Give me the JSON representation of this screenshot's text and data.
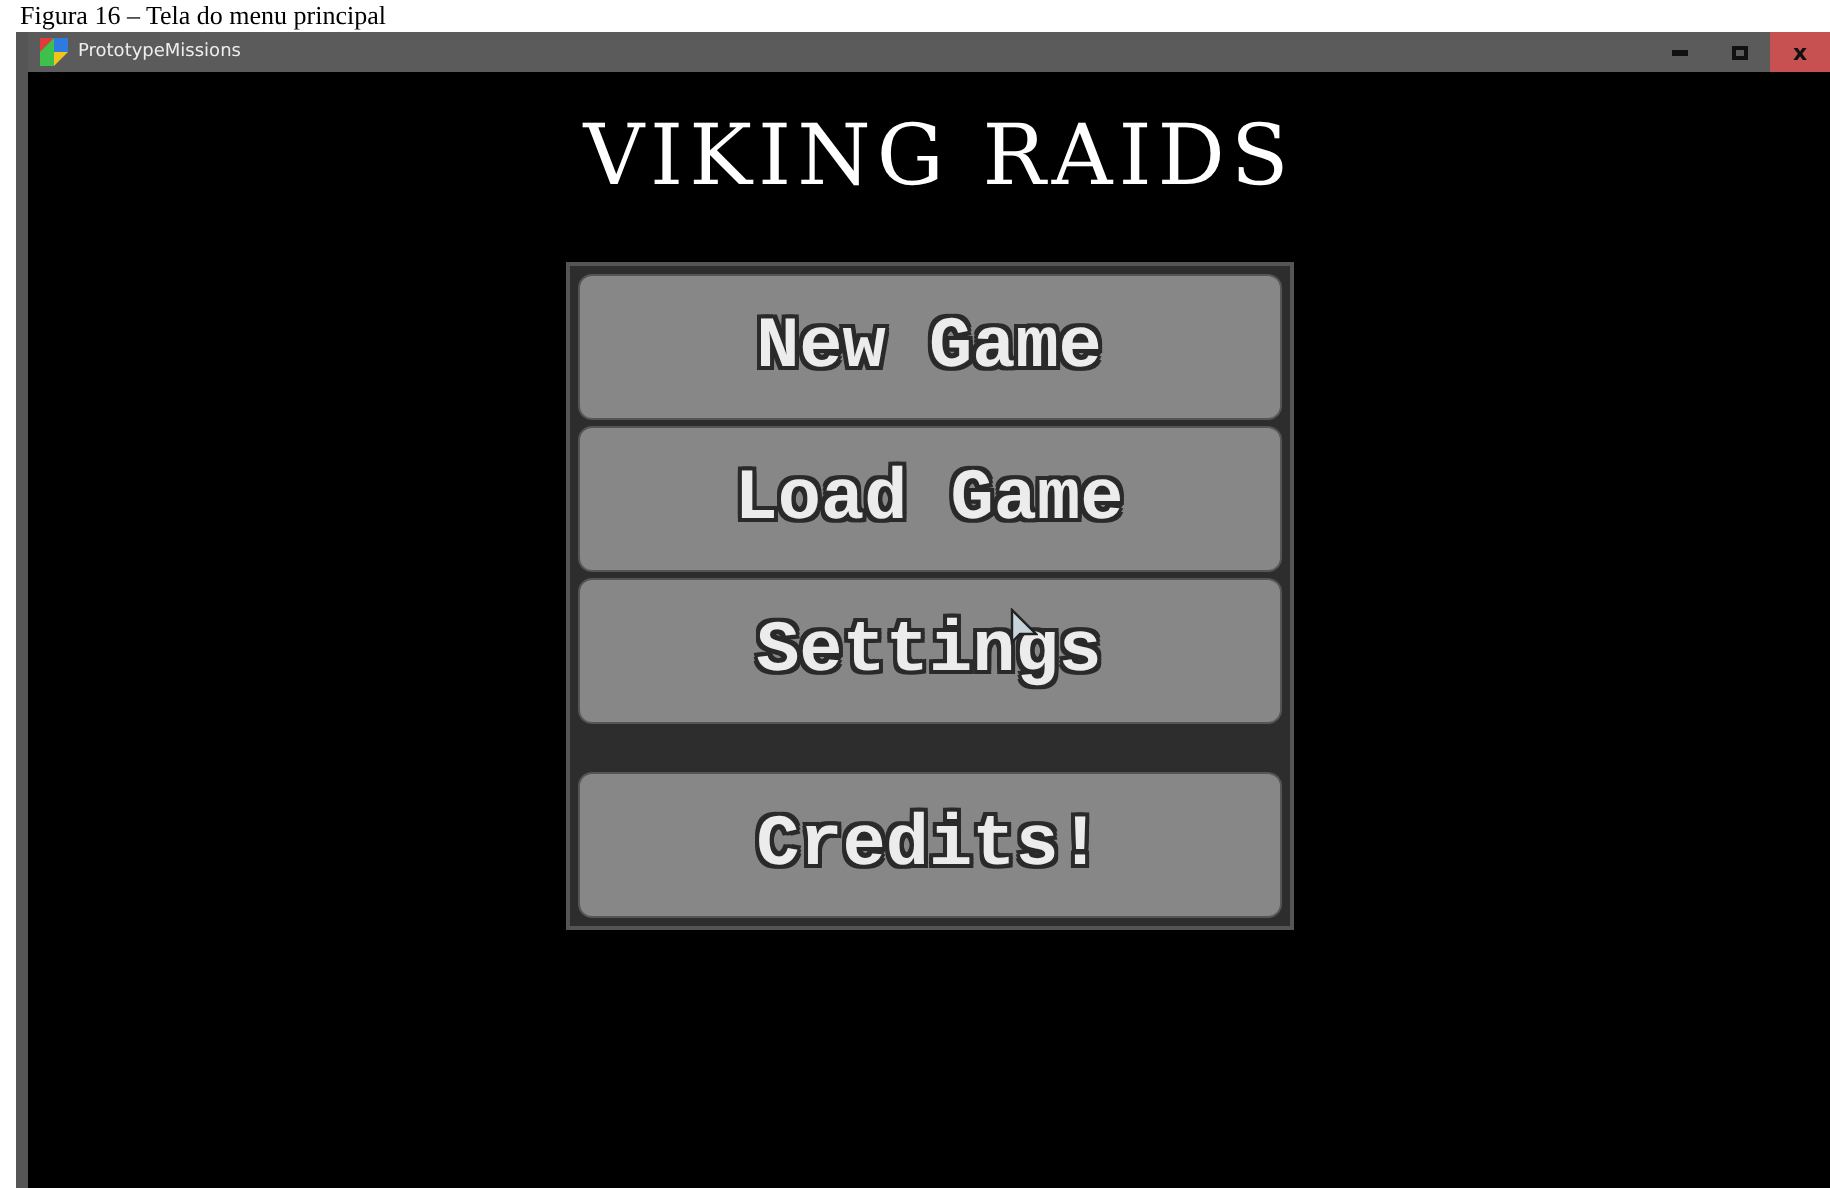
{
  "caption": "Figura 16 – Tela do menu principal",
  "window": {
    "title": "PrototypeMissions",
    "close_label": "x"
  },
  "game_title": "VIKING RAIDS",
  "menu": {
    "main_items": [
      {
        "label": "New Game"
      },
      {
        "label": "Load Game"
      },
      {
        "label": "Settings"
      }
    ],
    "extra_items": [
      {
        "label": "Credits!"
      }
    ]
  }
}
